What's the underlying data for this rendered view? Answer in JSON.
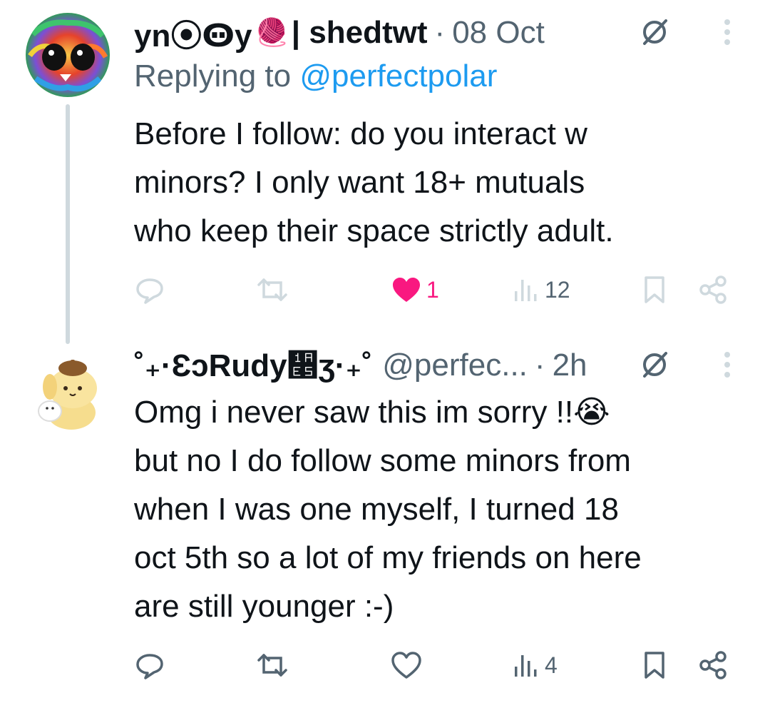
{
  "colors": {
    "muted": "#536471",
    "link": "#1d9bf0",
    "like_active": "#f91880",
    "thread_line": "#cfd9de",
    "text": "#0f1419"
  },
  "tweets": [
    {
      "display_name": "yn⦿Ꙫy",
      "name_emoji": "🧶",
      "suffix": "| shedtwt",
      "separator": "·",
      "timestamp": "08 Oct",
      "replying_prefix": "Replying to",
      "replying_handle": "@perfectpolar",
      "body": [
        "Before I follow: do you interact w",
        "minors? I only want 18+ mutuals",
        "who keep their space strictly adult."
      ],
      "icons": {
        "avatar": "rainbow-yarn-avatar",
        "status": "circle-slash-icon",
        "more": "more-vertical-icon"
      },
      "actions": {
        "reply": "",
        "retweet": "",
        "likes": "1",
        "liked": true,
        "views": "12"
      }
    },
    {
      "display_name": "˚₊·ƐɔRudy᫥ʒ·₊˚",
      "handle": "@perfec...",
      "separator": "·",
      "timestamp": "2h",
      "body": [
        "Omg i never saw this im sorry !!😭",
        "but no I do follow some minors from",
        "when I was one myself, I turned 18",
        "oct 5th so a lot of my friends on here",
        "are still younger :-)"
      ],
      "icons": {
        "avatar": "pompompurin-plush-avatar",
        "status": "circle-slash-icon",
        "more": "more-vertical-icon"
      },
      "actions": {
        "reply": "",
        "retweet": "",
        "likes": "",
        "liked": false,
        "views": "4"
      }
    }
  ]
}
